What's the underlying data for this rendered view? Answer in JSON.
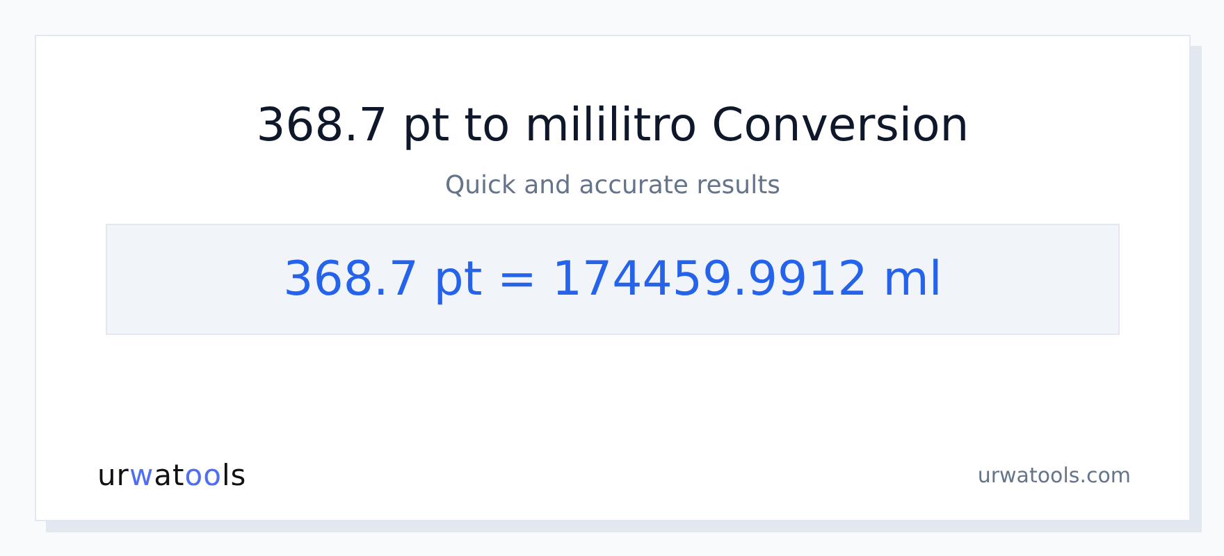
{
  "title": "368.7 pt to mililitro Conversion",
  "subtitle": "Quick and accurate results",
  "result": "368.7 pt = 174459.9912 ml",
  "logo": [
    {
      "text": "ur",
      "accent": false
    },
    {
      "text": "w",
      "accent": true
    },
    {
      "text": "at",
      "accent": false
    },
    {
      "text": "oo",
      "accent": true
    },
    {
      "text": "ls",
      "accent": false
    }
  ],
  "site": "urwatools.com"
}
